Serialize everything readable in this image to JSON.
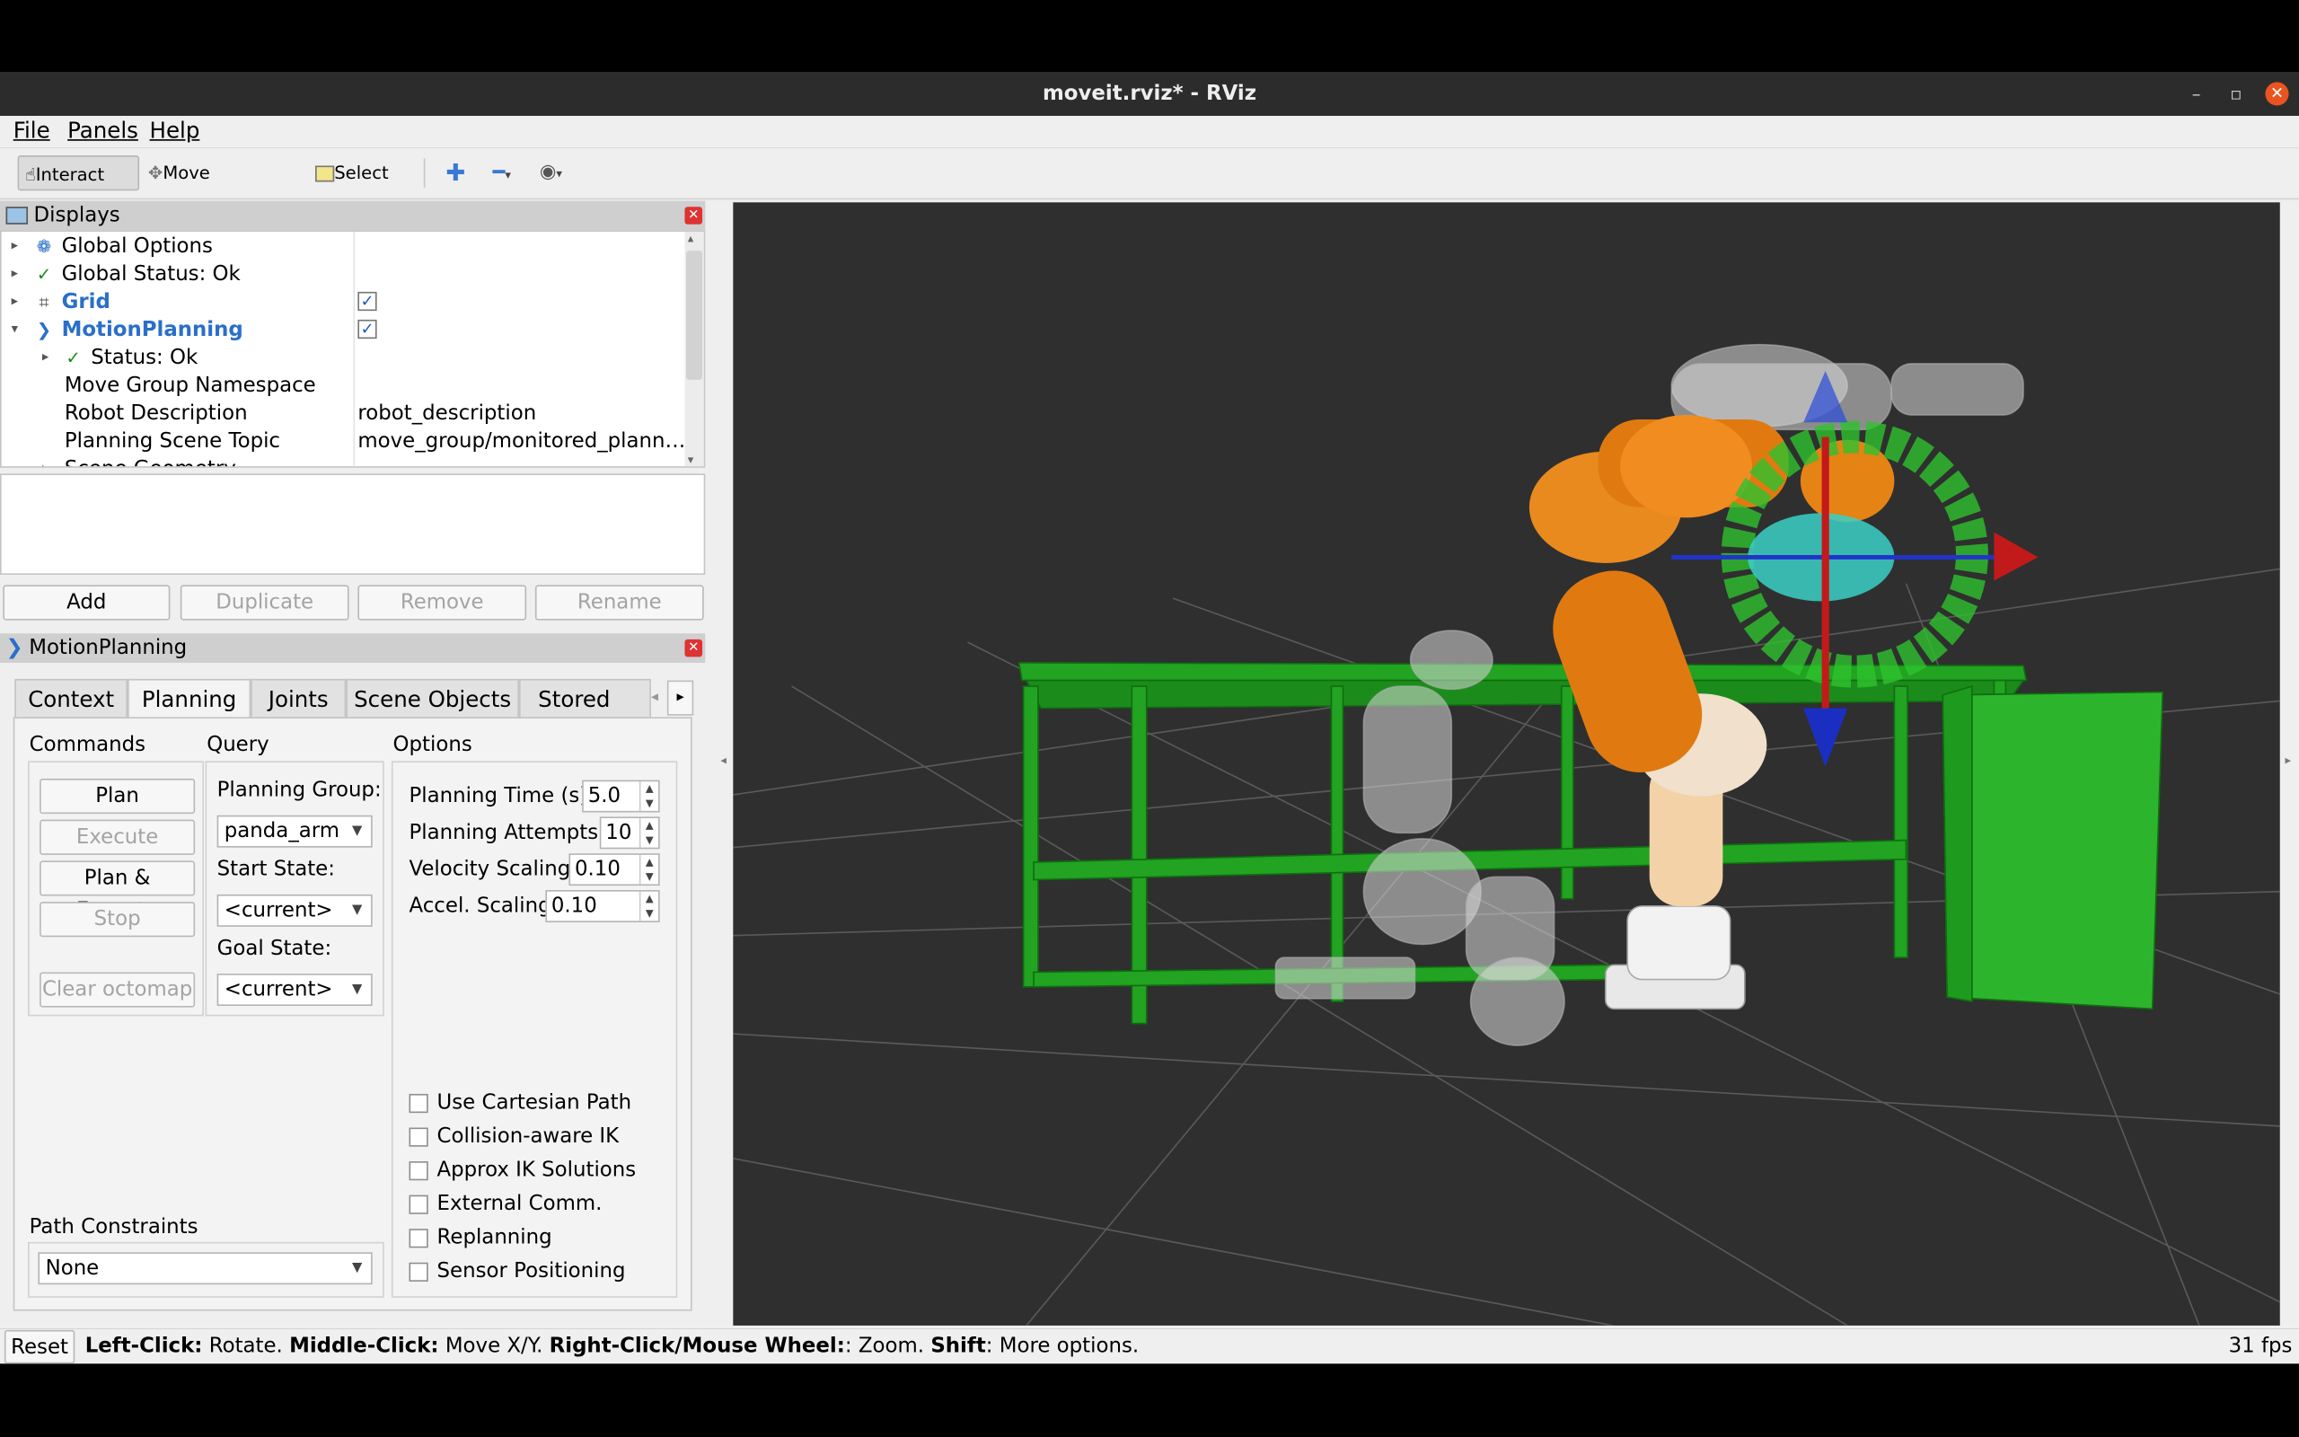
{
  "window": {
    "title": "moveit.rviz* - RViz",
    "close_symbol": "✕",
    "min_symbol": "–",
    "max_symbol": "▫"
  },
  "menubar": {
    "items": [
      {
        "label": "File"
      },
      {
        "label": "Panels"
      },
      {
        "label": "Help"
      }
    ]
  },
  "toolbar": {
    "interact": "Interact",
    "move_camera": "Move Camera",
    "select": "Select",
    "icons": [
      "hand-cursor-icon",
      "camera-move-icon",
      "select-rect-icon",
      "add-tool-icon",
      "remove-tool-icon",
      "eye-view-icon"
    ]
  },
  "displays": {
    "title": "Displays",
    "rows": [
      {
        "label": "Global Options",
        "value": ""
      },
      {
        "label": "Global Status: Ok",
        "value": ""
      },
      {
        "label": "Grid",
        "value": ""
      },
      {
        "label": "MotionPlanning",
        "value": ""
      },
      {
        "label": "Status: Ok",
        "value": ""
      },
      {
        "label": "Move Group Namespace",
        "value": ""
      },
      {
        "label": "Robot Description",
        "value": "robot_description"
      },
      {
        "label": "Planning Scene Topic",
        "value": "move_group/monitored_plann…"
      },
      {
        "label": "Scene Geometry",
        "value": ""
      }
    ],
    "grid_checked": true,
    "motion_planning_checked": true,
    "buttons": {
      "add": "Add",
      "duplicate": "Duplicate",
      "remove": "Remove",
      "rename": "Rename"
    }
  },
  "motion_planning": {
    "title": "MotionPlanning",
    "tabs": [
      {
        "label": "Context"
      },
      {
        "label": "Planning"
      },
      {
        "label": "Joints"
      },
      {
        "label": "Scene Objects"
      },
      {
        "label": "Stored Scei"
      }
    ],
    "selected_tab": "Planning",
    "commands": {
      "heading": "Commands",
      "plan": "Plan",
      "execute": "Execute",
      "plan_execute": "Plan & Execute",
      "stop": "Stop",
      "clear_octomap": "Clear octomap"
    },
    "query": {
      "heading": "Query",
      "planning_group_label": "Planning Group:",
      "planning_group": "panda_arm",
      "start_state_label": "Start State:",
      "start_state": "<current>",
      "goal_state_label": "Goal State:",
      "goal_state": "<current>"
    },
    "options": {
      "heading": "Options",
      "planning_time_label": "Planning Time (s):",
      "planning_time": "5.0",
      "planning_attempts_label": "Planning Attempts:",
      "planning_attempts": "10",
      "velocity_scaling_label": "Velocity Scaling:",
      "velocity_scaling": "0.10",
      "accel_scaling_label": "Accel. Scaling:",
      "accel_scaling": "0.10",
      "checkboxes": [
        {
          "label": "Use Cartesian Path",
          "checked": false
        },
        {
          "label": "Collision-aware IK",
          "checked": false
        },
        {
          "label": "Approx IK Solutions",
          "checked": false
        },
        {
          "label": "External Comm.",
          "checked": false
        },
        {
          "label": "Replanning",
          "checked": false
        },
        {
          "label": "Sensor Positioning",
          "checked": false
        }
      ]
    },
    "path_constraints": {
      "label": "Path Constraints",
      "value": "None"
    }
  },
  "statusbar": {
    "reset": "Reset",
    "hint_bold_1": "Left-Click:",
    "hint_1": " Rotate. ",
    "hint_bold_2": "Middle-Click:",
    "hint_2": " Move X/Y. ",
    "hint_bold_3": "Right-Click/Mouse Wheel:",
    "hint_3": ": Zoom. ",
    "hint_bold_4": "Shift",
    "hint_4": ": More options.",
    "fps": "31 fps"
  },
  "colors": {
    "viewport_bg": "#2f2f2f",
    "grid_line": "#5a5a5a",
    "robot_orange": "#e07a10",
    "robot_white": "#e8e8e8",
    "table_green": "#22b022",
    "link_blue": "#2a6fc9"
  }
}
